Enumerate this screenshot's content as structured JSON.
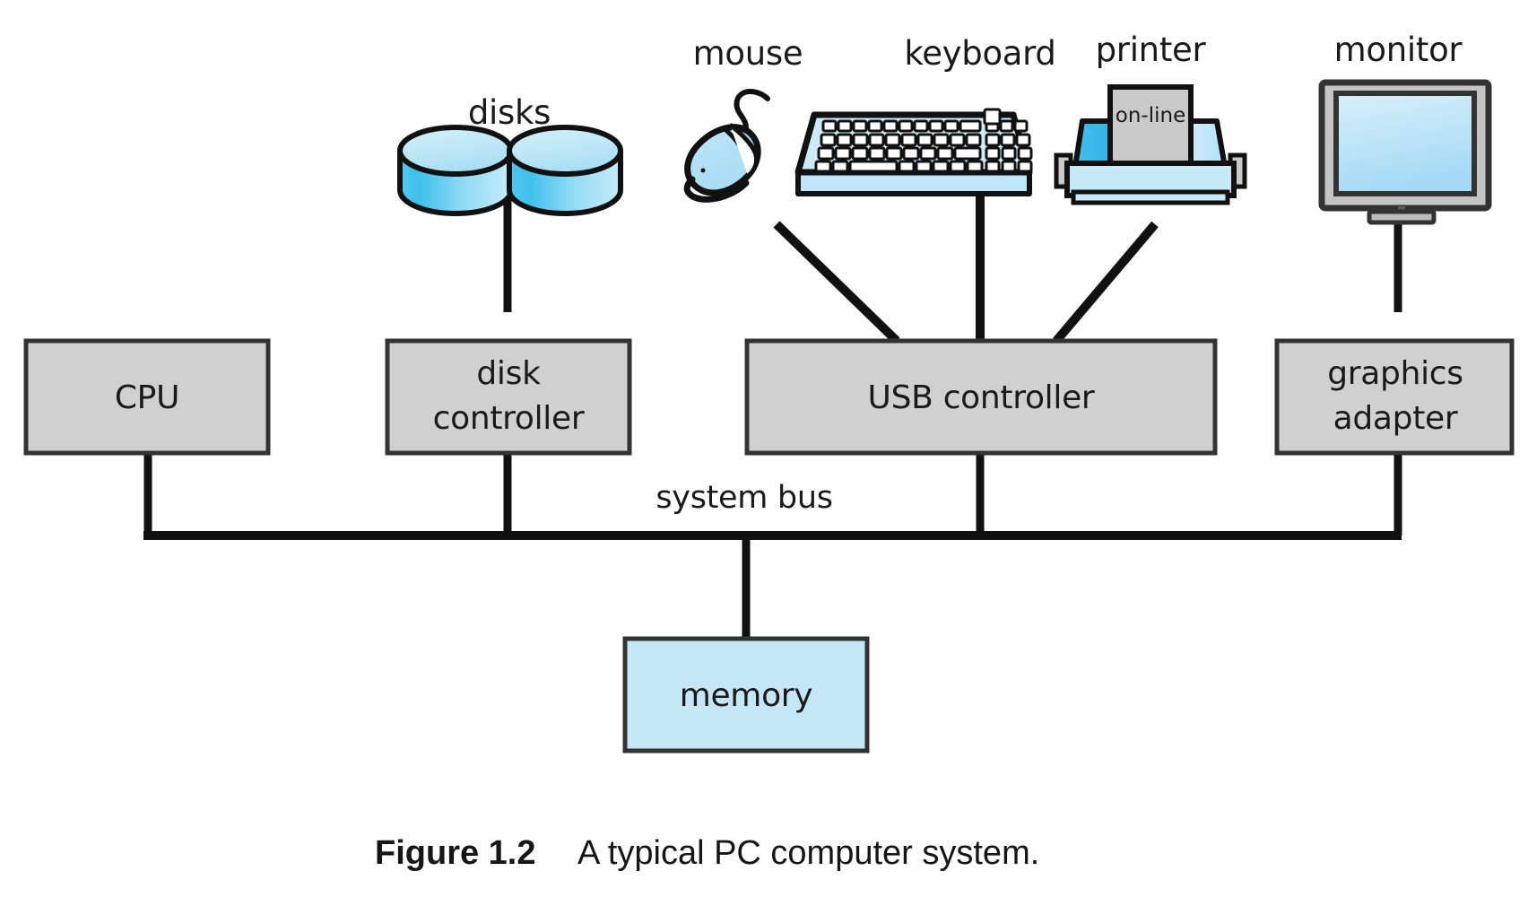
{
  "figure": {
    "caption_bold": "Figure 1.2",
    "caption_text": "A typical PC computer system."
  },
  "colors": {
    "box_gray_fill": "#d0d0d0",
    "memory_blue_fill": "#c5e6f7",
    "device_light_blue": "#c7e8f7",
    "device_mid_blue": "#38b6ea",
    "outline": "#1a1a1a",
    "paper_gray": "#c9c9c9",
    "monitor_bezel": "#c4c4c4",
    "background": "#ffffff"
  },
  "devices": [
    {
      "id": "disks",
      "label": "disks",
      "icon": "disks-icon"
    },
    {
      "id": "mouse",
      "label": "mouse",
      "icon": "mouse-icon"
    },
    {
      "id": "keyboard",
      "label": "keyboard",
      "icon": "keyboard-icon"
    },
    {
      "id": "printer",
      "label": "printer",
      "icon": "printer-icon"
    },
    {
      "id": "monitor",
      "label": "monitor",
      "icon": "monitor-icon"
    }
  ],
  "printer": {
    "status_label": "on-line"
  },
  "boxes": [
    {
      "id": "cpu",
      "lines": [
        "CPU"
      ],
      "fill": "gray"
    },
    {
      "id": "disk-controller",
      "lines": [
        "disk",
        "controller"
      ],
      "fill": "gray"
    },
    {
      "id": "usb-controller",
      "lines": [
        "USB controller"
      ],
      "fill": "gray"
    },
    {
      "id": "graphics-adapter",
      "lines": [
        "graphics",
        "adapter"
      ],
      "fill": "gray"
    },
    {
      "id": "memory",
      "lines": [
        "memory"
      ],
      "fill": "blue"
    }
  ],
  "bus": {
    "label": "system bus"
  },
  "labels": {
    "disks": "disks",
    "mouse": "mouse",
    "keyboard": "keyboard",
    "printer": "printer",
    "monitor": "monitor",
    "cpu": "CPU",
    "disk_controller_line1": "disk",
    "disk_controller_line2": "controller",
    "usb_controller": "USB controller",
    "graphics_adapter_line1": "graphics",
    "graphics_adapter_line2": "adapter",
    "memory": "memory",
    "system_bus": "system bus",
    "on_line": "on-line"
  }
}
